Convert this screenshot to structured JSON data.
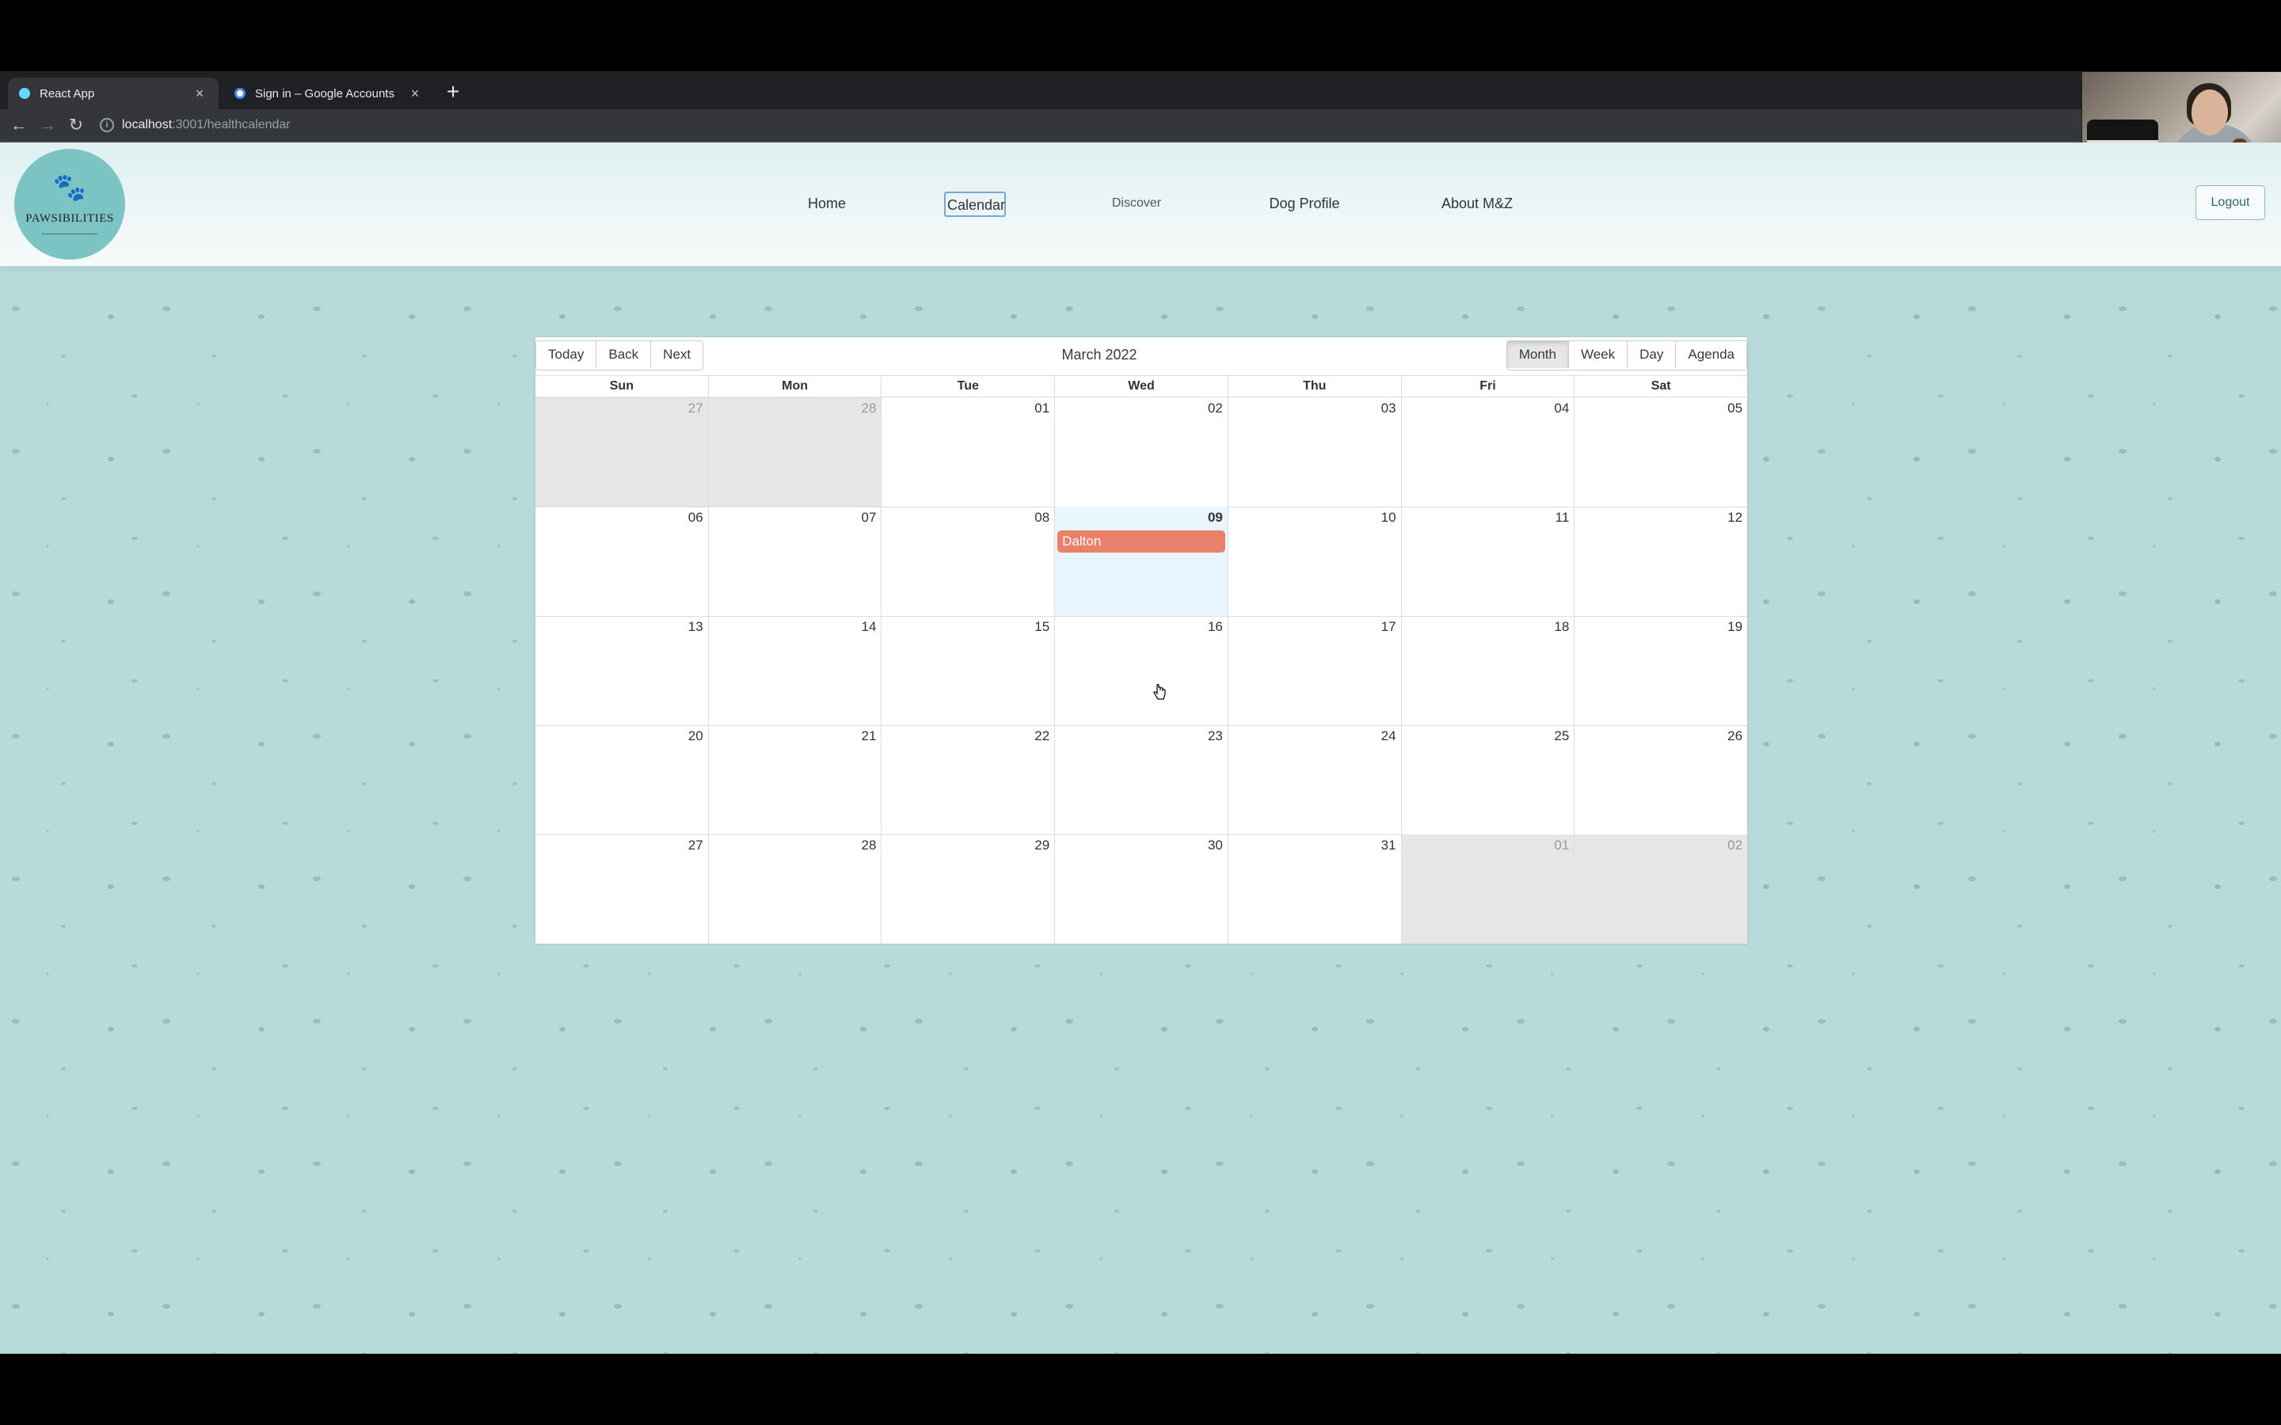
{
  "browser": {
    "tabs": [
      {
        "title": "React App",
        "active": true
      },
      {
        "title": "Sign in – Google Accounts",
        "active": false
      }
    ],
    "new_tab": "+",
    "url": {
      "host": "localhost",
      "path": ":3001/healthcalendar"
    },
    "nav": {
      "back": "←",
      "forward": "→",
      "reload": "↻",
      "close": "×"
    }
  },
  "site": {
    "logo_text": "PAWSIBILITIES",
    "nav": [
      "Home",
      "Calendar",
      "Discover",
      "Dog Profile",
      "About M&Z"
    ],
    "active_nav": "Calendar",
    "logout": "Logout"
  },
  "calendar": {
    "toolbar": {
      "today": "Today",
      "back": "Back",
      "next": "Next",
      "label": "March 2022",
      "views": [
        "Month",
        "Week",
        "Day",
        "Agenda"
      ],
      "active_view": "Month"
    },
    "weekdays": [
      "Sun",
      "Mon",
      "Tue",
      "Wed",
      "Thu",
      "Fri",
      "Sat"
    ],
    "weeks": [
      [
        {
          "n": "27",
          "off": true
        },
        {
          "n": "28",
          "off": true
        },
        {
          "n": "01"
        },
        {
          "n": "02"
        },
        {
          "n": "03"
        },
        {
          "n": "04"
        },
        {
          "n": "05"
        }
      ],
      [
        {
          "n": "06"
        },
        {
          "n": "07"
        },
        {
          "n": "08"
        },
        {
          "n": "09",
          "today": true,
          "event": "Dalton"
        },
        {
          "n": "10"
        },
        {
          "n": "11"
        },
        {
          "n": "12"
        }
      ],
      [
        {
          "n": "13"
        },
        {
          "n": "14"
        },
        {
          "n": "15"
        },
        {
          "n": "16"
        },
        {
          "n": "17"
        },
        {
          "n": "18"
        },
        {
          "n": "19"
        }
      ],
      [
        {
          "n": "20"
        },
        {
          "n": "21"
        },
        {
          "n": "22"
        },
        {
          "n": "23"
        },
        {
          "n": "24"
        },
        {
          "n": "25"
        },
        {
          "n": "26"
        }
      ],
      [
        {
          "n": "27"
        },
        {
          "n": "28"
        },
        {
          "n": "29"
        },
        {
          "n": "30"
        },
        {
          "n": "31"
        },
        {
          "n": "01",
          "off": true
        },
        {
          "n": "02",
          "off": true
        }
      ]
    ],
    "colors": {
      "event": "#e9806a",
      "today": "#eaf6ff",
      "off_range": "#e6e6e6"
    }
  },
  "colors": {
    "page_bg": "#b7dada",
    "logo_bg": "#7cc4c3",
    "accent": "#2f6868"
  }
}
